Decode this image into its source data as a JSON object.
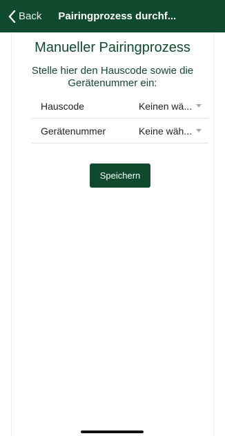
{
  "nav": {
    "back_label": "Back",
    "title": "Pairingprozess durchf..."
  },
  "main": {
    "heading": "Manueller Pairingprozess",
    "instruction": "Stelle hier den Hauscode sowie die Gerätenummer ein:",
    "fields": [
      {
        "label": "Hauscode",
        "value": "Keinen wä..."
      },
      {
        "label": "Gerätenummer",
        "value": "Keine wäh..."
      }
    ],
    "save_label": "Speichern"
  },
  "colors": {
    "brand": "#0f4a2f",
    "background": "#ffffff"
  },
  "icons": {
    "back": "chevron-left-icon",
    "dropdown": "caret-down-icon"
  }
}
